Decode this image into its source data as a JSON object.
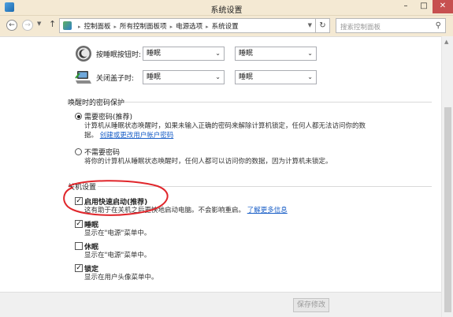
{
  "window": {
    "title": "系统设置",
    "minimize_label": "–",
    "maximize_label": "□",
    "close_label": "✕"
  },
  "nav": {
    "back_glyph": "←",
    "forward_glyph": "→",
    "up_glyph": "↑",
    "breadcrumbs": [
      "控制面板",
      "所有控制面板项",
      "电源选项",
      "系统设置"
    ],
    "search_placeholder": "搜索控制面板"
  },
  "power_buttons": {
    "sleep_button": {
      "label": "按睡眠按钮时:",
      "battery_value": "睡眠",
      "plugged_value": "睡眠",
      "icon": "sleep-button-icon"
    },
    "lid_close": {
      "label": "关闭盖子时:",
      "battery_value": "睡眠",
      "plugged_value": "睡眠",
      "icon": "laptop-lid-icon"
    }
  },
  "password_protection": {
    "title": "唤醒时的密码保护",
    "require": {
      "label": "需要密码(推荐)",
      "desc": "计算机从睡眠状态唤醒时，如果未输入正确的密码来解除计算机锁定，任何人都无法访问你的数",
      "desc2": "据。",
      "link": "创建或更改用户帐户密码",
      "selected": true
    },
    "no_require": {
      "label": "不需要密码",
      "desc": "将你的计算机从睡眠状态唤醒时，任何人都可以访问你的数据，因为计算机未锁定。",
      "selected": false
    }
  },
  "shutdown_settings": {
    "title": "关机设置",
    "options": [
      {
        "label": "启用快速启动(推荐)",
        "desc": "这有助于在关机之后更快地启动电脑。不会影响重启。",
        "link": "了解更多信息",
        "checked": true,
        "bold": true
      },
      {
        "label": "睡眠",
        "desc": "显示在\"电源\"菜单中。",
        "checked": true,
        "bold": false
      },
      {
        "label": "休眠",
        "desc": "显示在\"电源\"菜单中。",
        "checked": false,
        "bold": false
      },
      {
        "label": "锁定",
        "desc": "显示在用户头像菜单中。",
        "checked": true,
        "bold": false
      }
    ]
  },
  "footer": {
    "save_label": "保存修改"
  },
  "colors": {
    "titlebar": "#f4e9d3",
    "close_button": "#c75050",
    "link": "#1a5fc7",
    "annotation": "#e0262b"
  }
}
